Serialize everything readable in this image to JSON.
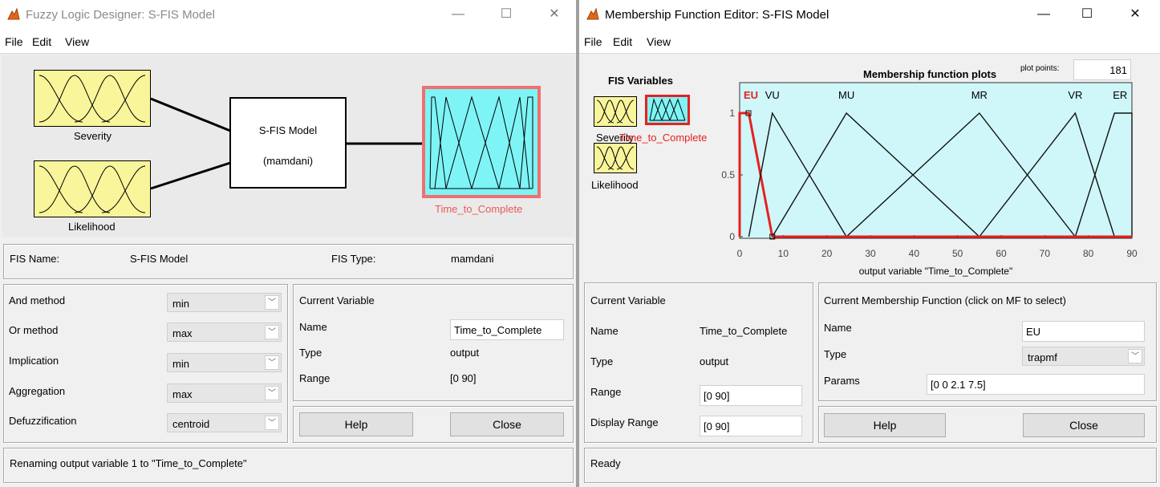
{
  "designer": {
    "title": "Fuzzy Logic Designer: S-FIS Model",
    "menu": [
      "File",
      "Edit",
      "View"
    ],
    "diagram": {
      "input1": "Severity",
      "input2": "Likelihood",
      "model_name": "S-FIS Model",
      "model_type": "(mamdani)",
      "output": "Time_to_Complete"
    },
    "fis_name_label": "FIS Name:",
    "fis_name": "S-FIS Model",
    "fis_type_label": "FIS Type:",
    "fis_type": "mamdani",
    "methods": [
      {
        "label": "And method",
        "value": "min"
      },
      {
        "label": "Or method",
        "value": "max"
      },
      {
        "label": "Implication",
        "value": "min"
      },
      {
        "label": "Aggregation",
        "value": "max"
      },
      {
        "label": "Defuzzification",
        "value": "centroid"
      }
    ],
    "current_variable": {
      "heading": "Current Variable",
      "name_label": "Name",
      "name": "Time_to_Complete",
      "type_label": "Type",
      "type": "output",
      "range_label": "Range",
      "range": "[0 90]"
    },
    "help_label": "Help",
    "close_label": "Close",
    "status": "Renaming output variable 1 to \"Time_to_Complete\""
  },
  "mf_editor": {
    "title": "Membership Function Editor: S-FIS Model",
    "menu": [
      "File",
      "Edit",
      "View"
    ],
    "fis_variables_label": "FIS Variables",
    "variables": [
      "Severity",
      "Time_to_Complete",
      "Likelihood"
    ],
    "plot_title": "Membership function plots",
    "plot_points_label": "plot points:",
    "plot_points": "181",
    "current_variable": {
      "heading": "Current Variable",
      "name_label": "Name",
      "name": "Time_to_Complete",
      "type_label": "Type",
      "type": "output",
      "range_label": "Range",
      "range": "[0 90]",
      "display_range_label": "Display Range",
      "display_range": "[0 90]"
    },
    "current_mf": {
      "heading": "Current Membership Function (click on MF to select)",
      "name_label": "Name",
      "name": "EU",
      "type_label": "Type",
      "type": "trapmf",
      "params_label": "Params",
      "params": "[0 0 2.1 7.5]"
    },
    "help_label": "Help",
    "close_label": "Close",
    "status": "Ready"
  },
  "chart_data": {
    "type": "line",
    "title": "Membership function plots",
    "xlabel": "output variable \"Time_to_Complete\"",
    "xlim": [
      0,
      90
    ],
    "ylim": [
      0,
      1
    ],
    "x_ticks": [
      "0",
      "10",
      "20",
      "30",
      "40",
      "50",
      "60",
      "70",
      "80",
      "90"
    ],
    "y_ticks": [
      "0",
      "0.5",
      "1"
    ],
    "selected": "EU",
    "series": [
      {
        "name": "EU",
        "x": [
          0,
          0,
          2.1,
          7.5
        ],
        "y": [
          0,
          1,
          1,
          0
        ]
      },
      {
        "name": "VU",
        "x": [
          2.1,
          7.5,
          24.5
        ],
        "y": [
          0,
          1,
          0
        ]
      },
      {
        "name": "MU",
        "x": [
          7.5,
          24.5,
          55
        ],
        "y": [
          0,
          1,
          0
        ]
      },
      {
        "name": "MR",
        "x": [
          24.5,
          55,
          77
        ],
        "y": [
          0,
          1,
          0
        ]
      },
      {
        "name": "VR",
        "x": [
          55,
          77,
          86
        ],
        "y": [
          0,
          1,
          0
        ]
      },
      {
        "name": "ER",
        "x": [
          77,
          86,
          90,
          90
        ],
        "y": [
          0,
          1,
          1,
          0
        ]
      }
    ]
  },
  "colors": {
    "plot_bg": "#cff7f9",
    "input_box": "#f8f59a",
    "output_box": "#7ef4f6",
    "selected": "#e82020",
    "selected_output_label": "#e85a5a"
  }
}
